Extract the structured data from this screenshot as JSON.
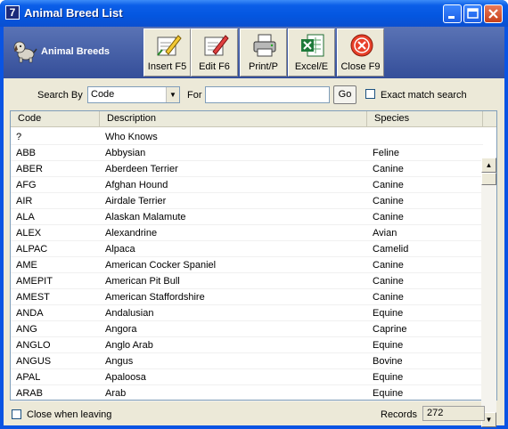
{
  "window": {
    "title": "Animal Breed List",
    "app_icon_glyph": "7"
  },
  "banner": {
    "label": "Animal Breeds",
    "icon": "dog-icon"
  },
  "toolbar": {
    "buttons": [
      {
        "label": "Insert F5",
        "icon": "insert-pencil-icon"
      },
      {
        "label": "Edit F6",
        "icon": "edit-pencil-icon"
      },
      {
        "label": "Print/P",
        "icon": "printer-icon"
      },
      {
        "label": "Excel/E",
        "icon": "excel-icon"
      },
      {
        "label": "Close F9",
        "icon": "close-circle-icon"
      }
    ]
  },
  "search": {
    "search_by_label": "Search By",
    "search_by_value": "Code",
    "for_label": "For",
    "for_value": "",
    "go_label": "Go",
    "exact_match_label": "Exact match search",
    "exact_match_checked": false
  },
  "grid": {
    "columns": [
      "Code",
      "Description",
      "Species"
    ],
    "rows": [
      [
        "?",
        "Who Knows",
        ""
      ],
      [
        "ABB",
        "Abbysian",
        "Feline"
      ],
      [
        "ABER",
        "Aberdeen Terrier",
        "Canine"
      ],
      [
        "AFG",
        "Afghan Hound",
        "Canine"
      ],
      [
        "AIR",
        "Airdale Terrier",
        "Canine"
      ],
      [
        "ALA",
        "Alaskan Malamute",
        "Canine"
      ],
      [
        "ALEX",
        "Alexandrine",
        "Avian"
      ],
      [
        "ALPAC",
        "Alpaca",
        "Camelid"
      ],
      [
        "AME",
        "American Cocker Spaniel",
        "Canine"
      ],
      [
        "AMEPIT",
        "American Pit Bull",
        "Canine"
      ],
      [
        "AMEST",
        "American Staffordshire",
        "Canine"
      ],
      [
        "ANDA",
        "Andalusian",
        "Equine"
      ],
      [
        "ANG",
        "Angora",
        "Caprine"
      ],
      [
        "ANGLO",
        "Anglo Arab",
        "Equine"
      ],
      [
        "ANGUS",
        "Angus",
        "Bovine"
      ],
      [
        "APAL",
        "Apaloosa",
        "Equine"
      ],
      [
        "ARAB",
        "Arab",
        "Equine"
      ]
    ]
  },
  "footer": {
    "close_when_leaving_label": "Close when leaving",
    "close_when_leaving_checked": false,
    "records_label": "Records",
    "records_value": "272"
  },
  "colors": {
    "titlebar": "#0456e0",
    "banner": "#3d56a0",
    "window_bg": "#ece9d8"
  }
}
